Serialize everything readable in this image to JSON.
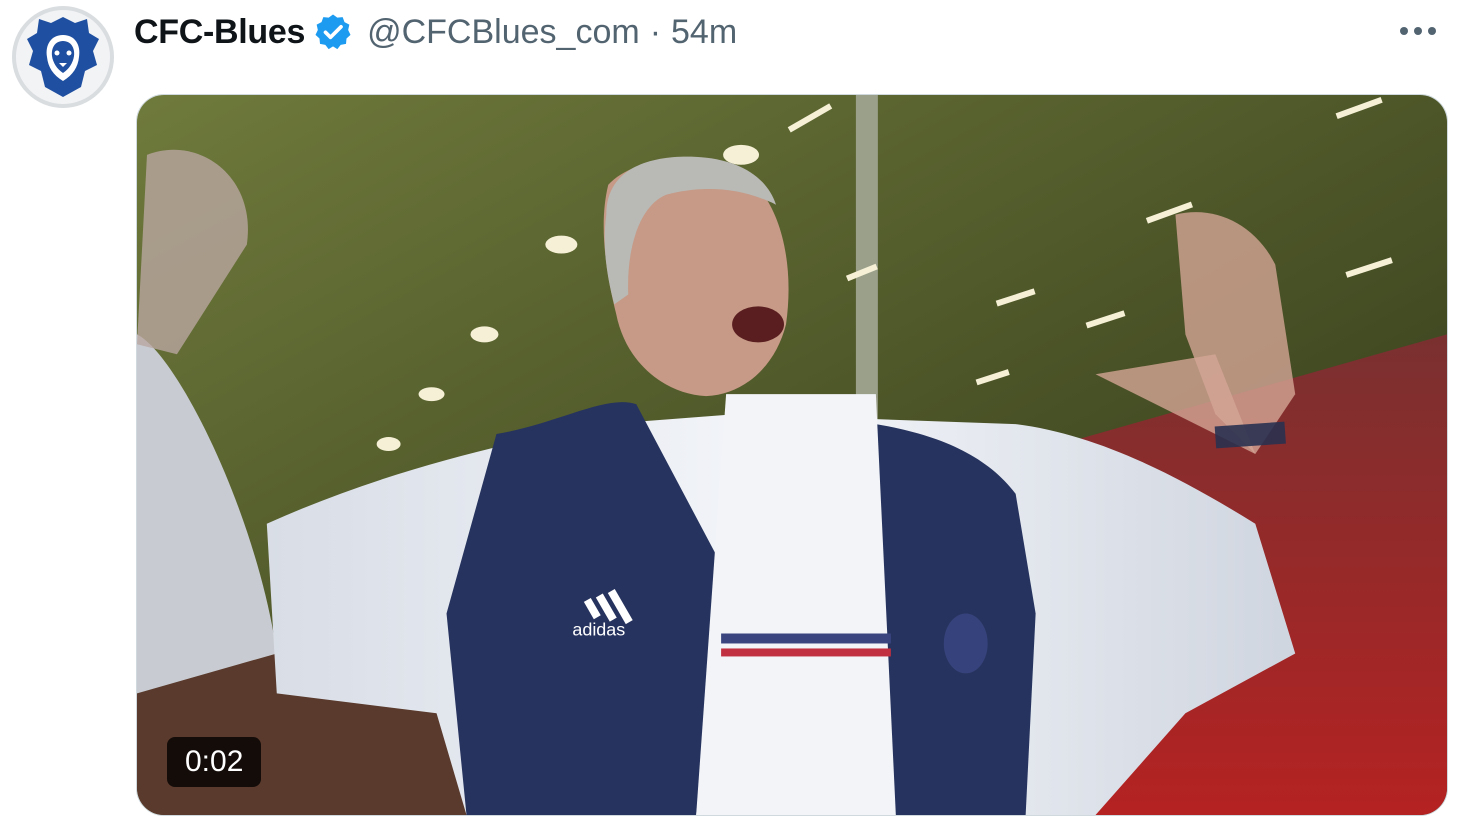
{
  "tweet": {
    "display_name": "CFC-Blues",
    "handle": "@CFCBlues_com",
    "separator": "·",
    "time": "54m",
    "verified": true,
    "avatar_icon": "lion-head-icon",
    "more_icon": "more-horizontal-icon"
  },
  "media": {
    "type": "video",
    "duration": "0:02",
    "overlay_logo_text": "adidas"
  },
  "colors": {
    "name": "#0f1419",
    "secondary": "#536471",
    "verified_badge": "#1d9bf0",
    "avatar_blue": "#1f4fa0"
  }
}
